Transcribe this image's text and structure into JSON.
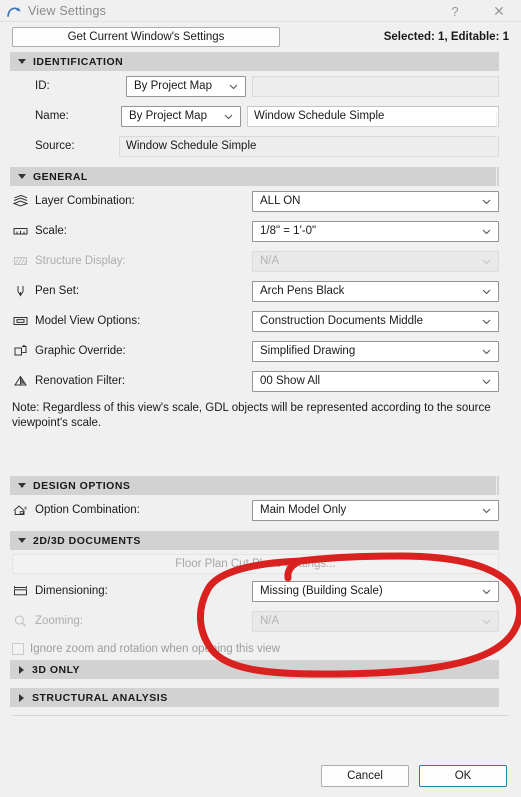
{
  "window": {
    "title": "View Settings",
    "app_icon": "archicad-arc-icon",
    "help_label": "?",
    "close_label": "✕"
  },
  "toolbar": {
    "get_settings_label": "Get Current Window's Settings",
    "selection_info": "Selected: 1, Editable: 1"
  },
  "sections": {
    "identification": {
      "title": "IDENTIFICATION",
      "expanded": true,
      "rows": {
        "id": {
          "label": "ID:",
          "combo_value": "By Project Map",
          "text_value": "",
          "enabled": true
        },
        "name": {
          "label": "Name:",
          "combo_value": "By Project Map",
          "text_value": "Window Schedule Simple",
          "enabled": true
        },
        "source": {
          "label": "Source:",
          "text_value": "Window Schedule Simple",
          "enabled": true
        }
      }
    },
    "general": {
      "title": "GENERAL",
      "expanded": true,
      "rows": [
        {
          "icon": "layers-stack-icon",
          "label": "Layer Combination:",
          "value": "ALL ON",
          "enabled": true
        },
        {
          "icon": "ruler-icon",
          "label": "Scale:",
          "value": "1/8\"  =   1'-0\"",
          "enabled": true
        },
        {
          "icon": "hatched-wall-icon",
          "label": "Structure Display:",
          "value": "N/A",
          "enabled": false
        },
        {
          "icon": "pen-nib-icon",
          "label": "Pen Set:",
          "value": "Arch Pens Black",
          "enabled": true
        },
        {
          "icon": "model-view-icon",
          "label": "Model View Options:",
          "value": "Construction Documents Middle",
          "enabled": true
        },
        {
          "icon": "graphic-override-icon",
          "label": "Graphic Override:",
          "value": "Simplified Drawing",
          "enabled": true
        },
        {
          "icon": "renovation-filter-icon",
          "label": "Renovation Filter:",
          "value": "00 Show All",
          "enabled": true
        }
      ],
      "note": "Note: Regardless of this view's scale, GDL objects will be represented according to the source viewpoint's scale."
    },
    "design_options": {
      "title": "DESIGN OPTIONS",
      "expanded": true,
      "rows": [
        {
          "icon": "design-option-house-icon",
          "label": "Option Combination:",
          "value": "Main Model Only",
          "enabled": true
        }
      ]
    },
    "documents_2d3d": {
      "title": "2D/3D DOCUMENTS",
      "expanded": true,
      "cut_plane_button": "Floor Plan Cut Plane Settings...",
      "rows": [
        {
          "icon": "dimension-bracket-icon",
          "label": "Dimensioning:",
          "value": "Missing (Building Scale)",
          "enabled": true
        },
        {
          "icon": "magnifier-icon",
          "label": "Zooming:",
          "value": "N/A",
          "enabled": false
        }
      ],
      "checkbox": {
        "label": "Ignore zoom and rotation when opening this view",
        "checked": false,
        "enabled": false
      }
    },
    "three_d_only": {
      "title": "3D ONLY",
      "expanded": false
    },
    "structural_analysis": {
      "title": "STRUCTURAL ANALYSIS",
      "expanded": false
    }
  },
  "footer": {
    "cancel_label": "Cancel",
    "ok_label": "OK"
  },
  "annotation": {
    "type": "hand-drawn-ellipse",
    "color": "#d9211f",
    "stroke_width": 7,
    "target": "Dimensioning / Zooming fields"
  },
  "colors": {
    "window_bg": "#f0f0f0",
    "section_header_bg": "#d2d2d2",
    "accent_button_border": "#2a7ca8",
    "disabled_text": "#b3b3b3",
    "title_text": "#8a8a8a",
    "annotation_red": "#d9211f"
  }
}
